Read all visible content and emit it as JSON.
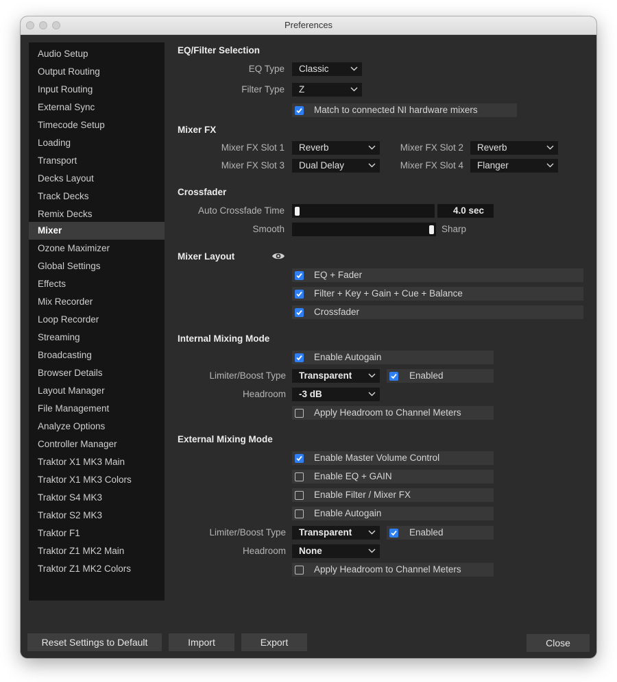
{
  "window": {
    "title": "Preferences"
  },
  "sidebar": {
    "items": [
      {
        "label": "Audio Setup"
      },
      {
        "label": "Output Routing"
      },
      {
        "label": "Input Routing"
      },
      {
        "label": "External Sync"
      },
      {
        "label": "Timecode Setup"
      },
      {
        "label": "Loading"
      },
      {
        "label": "Transport"
      },
      {
        "label": "Decks Layout"
      },
      {
        "label": "Track Decks"
      },
      {
        "label": "Remix Decks"
      },
      {
        "label": "Mixer"
      },
      {
        "label": "Ozone Maximizer"
      },
      {
        "label": "Global Settings"
      },
      {
        "label": "Effects"
      },
      {
        "label": "Mix Recorder"
      },
      {
        "label": "Loop Recorder"
      },
      {
        "label": "Streaming"
      },
      {
        "label": "Broadcasting"
      },
      {
        "label": "Browser Details"
      },
      {
        "label": "Layout Manager"
      },
      {
        "label": "File Management"
      },
      {
        "label": "Analyze Options"
      },
      {
        "label": "Controller Manager"
      },
      {
        "label": "Traktor X1 MK3 Main"
      },
      {
        "label": "Traktor X1 MK3 Colors"
      },
      {
        "label": "Traktor S4 MK3"
      },
      {
        "label": "Traktor S2 MK3"
      },
      {
        "label": "Traktor F1"
      },
      {
        "label": "Traktor Z1 MK2 Main"
      },
      {
        "label": "Traktor Z1 MK2 Colors"
      }
    ],
    "selected": "Mixer"
  },
  "eq_filter": {
    "heading": "EQ/Filter Selection",
    "eq_type_label": "EQ Type",
    "eq_type_value": "Classic",
    "filter_type_label": "Filter Type",
    "filter_type_value": "Z",
    "match_label": "Match to connected NI hardware mixers",
    "match_checked": true
  },
  "mixer_fx": {
    "heading": "Mixer FX",
    "slot1_label": "Mixer FX Slot 1",
    "slot1_value": "Reverb",
    "slot2_label": "Mixer FX Slot 2",
    "slot2_value": "Reverb",
    "slot3_label": "Mixer FX Slot 3",
    "slot3_value": "Dual Delay",
    "slot4_label": "Mixer FX Slot 4",
    "slot4_value": "Flanger"
  },
  "crossfader": {
    "heading": "Crossfader",
    "auto_time_label": "Auto Crossfade Time",
    "auto_time_value": "4.0 sec",
    "auto_time_position": 0.0,
    "smooth_label": "Smooth",
    "sharp_label": "Sharp",
    "curve_position": 1.0
  },
  "mixer_layout": {
    "heading": "Mixer Layout",
    "eye_icon": "eye-icon",
    "options": [
      {
        "label": "EQ + Fader",
        "checked": true
      },
      {
        "label": "Filter + Key + Gain + Cue + Balance",
        "checked": true
      },
      {
        "label": "Crossfader",
        "checked": true
      }
    ]
  },
  "internal_mixing": {
    "heading": "Internal Mixing Mode",
    "autogain_label": "Enable Autogain",
    "autogain_checked": true,
    "limiter_label": "Limiter/Boost Type",
    "limiter_value": "Transparent",
    "limiter_enabled_label": "Enabled",
    "limiter_enabled_checked": true,
    "headroom_label": "Headroom",
    "headroom_value": "-3 dB",
    "apply_headroom_label": "Apply Headroom to Channel Meters",
    "apply_headroom_checked": false
  },
  "external_mixing": {
    "heading": "External Mixing Mode",
    "options": [
      {
        "label": "Enable Master Volume Control",
        "checked": true
      },
      {
        "label": "Enable EQ + GAIN",
        "checked": false
      },
      {
        "label": "Enable Filter / Mixer FX",
        "checked": false
      },
      {
        "label": "Enable Autogain",
        "checked": false
      }
    ],
    "limiter_label": "Limiter/Boost Type",
    "limiter_value": "Transparent",
    "limiter_enabled_label": "Enabled",
    "limiter_enabled_checked": true,
    "headroom_label": "Headroom",
    "headroom_value": "None",
    "apply_headroom_label": "Apply Headroom to Channel Meters",
    "apply_headroom_checked": false
  },
  "footer": {
    "reset_label": "Reset Settings to Default",
    "import_label": "Import",
    "export_label": "Export",
    "close_label": "Close"
  },
  "colors": {
    "window_bg": "#2c2c2c",
    "sidebar_bg": "#151515",
    "selected_bg": "#3c3c3c",
    "checkbox_accent": "#2f7ff2"
  }
}
